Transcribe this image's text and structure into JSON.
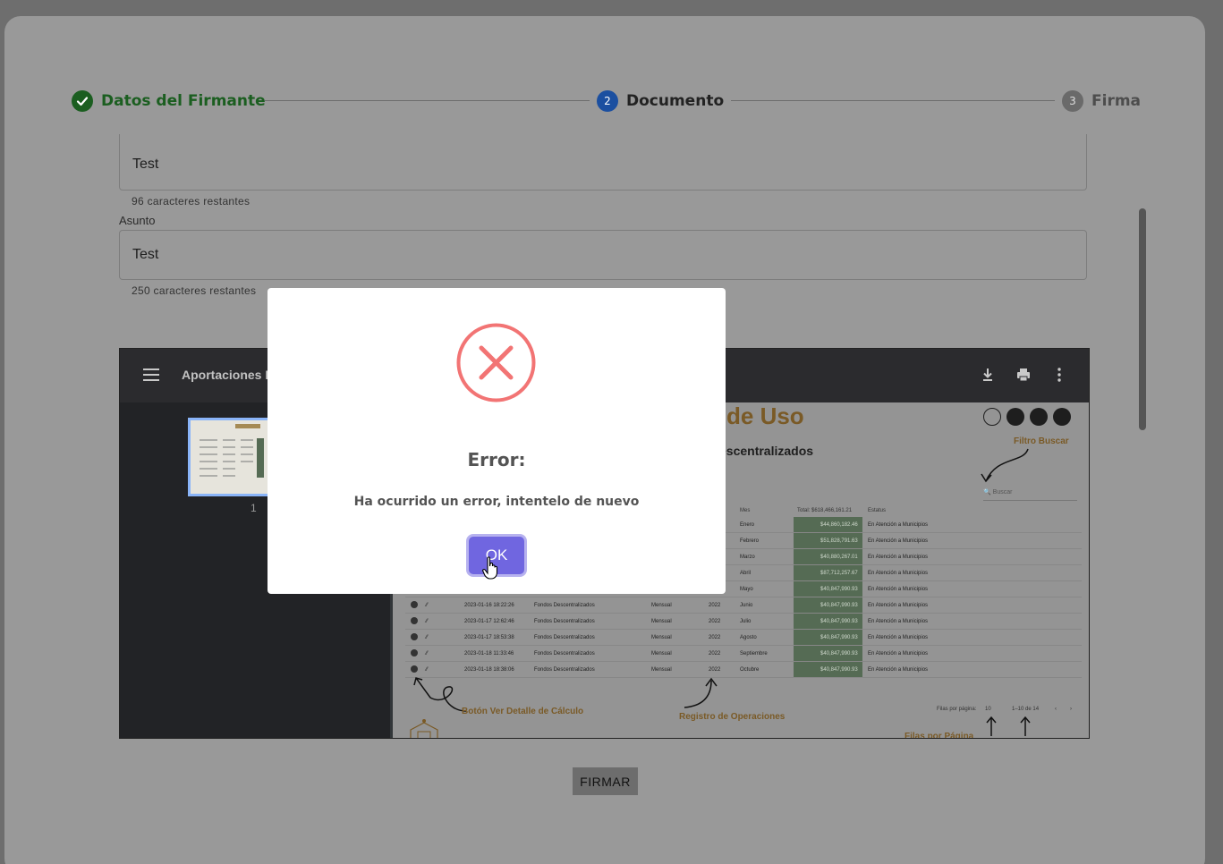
{
  "stepper": {
    "steps": [
      {
        "label": "Datos del Firmante",
        "status": "completed",
        "icon": "check-icon"
      },
      {
        "label": "Documento",
        "number": "2",
        "status": "active"
      },
      {
        "label": "Firma",
        "number": "3",
        "status": "pending"
      }
    ]
  },
  "form": {
    "first_field_value": "Test",
    "first_field_helper": "96 caracteres restantes",
    "asunto_label": "Asunto",
    "asunto_value": "Test",
    "asunto_helper": "250 caracteres restantes"
  },
  "viewer": {
    "title": "Aportaciones Es",
    "page_number": "1",
    "toolbar_icons": [
      "menu-icon",
      "download-icon",
      "print-icon",
      "more-vert-icon"
    ],
    "page": {
      "title_fragment": "de Uso",
      "subtitle_fragment": "escentralizados",
      "annotations": {
        "filtro": "Filtro Buscar",
        "detalle": "Botón Ver Detalle de Cálculo",
        "registro": "Registro de Operaciones",
        "filas": "Filas por Página"
      },
      "search_placeholder": "Buscar",
      "headers": {
        "mes": "Mes",
        "total": "Total: $618,466,161.21",
        "estatus": "Estatus"
      },
      "rows": [
        {
          "mes": "Enero",
          "total": "$44,860,182.46",
          "estatus": "En Atención a Municipios"
        },
        {
          "mes": "Febrero",
          "total": "$51,828,791.63",
          "estatus": "En Atención a Municipios"
        },
        {
          "mes": "Marzo",
          "total": "$40,880,267.01",
          "estatus": "En Atención a Municipios"
        },
        {
          "mes": "Abril",
          "total": "$87,712,257.67",
          "estatus": "En Atención a Municipios"
        },
        {
          "mes": "Mayo",
          "total": "$40,847,990.93",
          "estatus": "En Atención a Municipios"
        },
        {
          "fecha": "2023-01-16 18:22:26",
          "fondo": "Fondos Descentralizados",
          "periodo": "Mensual",
          "anio": "2022",
          "mes": "Junio",
          "total": "$40,847,990.93",
          "estatus": "En Atención a Municipios"
        },
        {
          "fecha": "2023-01-17 12:62:46",
          "fondo": "Fondos Descentralizados",
          "periodo": "Mensual",
          "anio": "2022",
          "mes": "Julio",
          "total": "$40,847,990.93",
          "estatus": "En Atención a Municipios"
        },
        {
          "fecha": "2023-01-17 18:53:38",
          "fondo": "Fondos Descentralizados",
          "periodo": "Mensual",
          "anio": "2022",
          "mes": "Agosto",
          "total": "$40,847,990.93",
          "estatus": "En Atención a Municipios"
        },
        {
          "fecha": "2023-01-18 11:33:46",
          "fondo": "Fondos Descentralizados",
          "periodo": "Mensual",
          "anio": "2022",
          "mes": "Septiembre",
          "total": "$40,847,990.93",
          "estatus": "En Atención a Municipios"
        },
        {
          "fecha": "2023-01-18 18:38:06",
          "fondo": "Fondos Descentralizados",
          "periodo": "Mensual",
          "anio": "2022",
          "mes": "Octubre",
          "total": "$40,847,990.93",
          "estatus": "En Atención a Municipios"
        }
      ],
      "pager": {
        "rows_label": "Filas por página:",
        "rows_value": "10",
        "range": "1–10 de 14"
      }
    }
  },
  "firmar_label": "FIRMAR",
  "modal": {
    "icon": "error-x-icon",
    "icon_color": "#f27474",
    "title": "Error:",
    "message": "Ha ocurrido un error, intentelo de nuevo",
    "ok_label": "OK",
    "ok_color": "#7066e0"
  }
}
